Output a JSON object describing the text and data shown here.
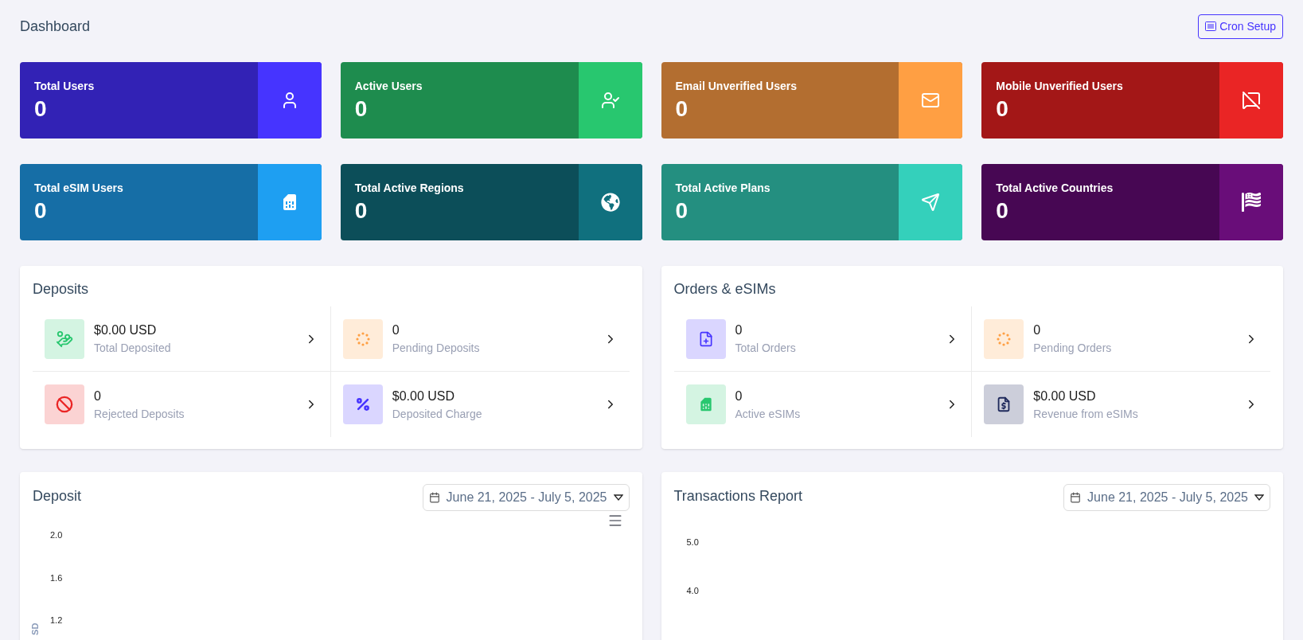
{
  "page_title": "Dashboard",
  "header_button": "Cron Setup",
  "stat_cards": [
    {
      "label": "Total Users",
      "value": "0",
      "color": "#3222b5",
      "icon_tile": {
        "color": "#4634ff"
      }
    },
    {
      "label": "Active Users",
      "value": "0",
      "color": "#1e8c4e",
      "icon_tile": {
        "color": "#28c76f"
      }
    },
    {
      "label": "Email Unverified Users",
      "value": "0",
      "color": "#b36e30",
      "icon_tile": {
        "color": "#ff9f43"
      }
    },
    {
      "label": "Mobile Unverified Users",
      "value": "0",
      "color": "#a31717",
      "icon_tile": {
        "color": "#ea2525"
      }
    },
    {
      "label": "Total eSIM Users",
      "value": "0",
      "color": "#166ea6",
      "icon_tile": {
        "color": "#1e9ff2"
      }
    },
    {
      "label": "Total Active Regions",
      "value": "0",
      "color": "#0c4e59",
      "icon_tile": {
        "color": "#10707e"
      }
    },
    {
      "label": "Total Active Plans",
      "value": "0",
      "color": "#248f80",
      "icon_tile": {
        "color": "#34d0bb"
      }
    },
    {
      "label": "Total Active Countries",
      "value": "0",
      "color": "#470753",
      "icon_tile": {
        "color": "#690d79"
      }
    }
  ],
  "panels": [
    {
      "title": "Deposits",
      "items": [
        {
          "value": "$0.00 USD",
          "label": "Total Deposited",
          "color": "#d4f4e2"
        },
        {
          "value": "0",
          "label": "Pending Deposits",
          "color": "#ffecd9"
        },
        {
          "value": "0",
          "label": "Rejected Deposits",
          "color": "#fbd3d3"
        },
        {
          "value": "$0.00 USD",
          "label": "Deposited Charge",
          "color": "#dad6ff"
        }
      ]
    },
    {
      "title": "Orders & eSIMs",
      "items": [
        {
          "value": "0",
          "label": "Total Orders",
          "color": "#dad6ff"
        },
        {
          "value": "0",
          "label": "Pending Orders",
          "color": "#ffecd9"
        },
        {
          "value": "0",
          "label": "Active eSIMs",
          "color": "#d4f4e2"
        },
        {
          "value": "$0.00 USD",
          "label": "Revenue from eSIMs",
          "color": "#ccceda"
        }
      ]
    }
  ],
  "charts": [
    {
      "title": "Deposit",
      "date_range": "June 21, 2025 - July 5, 2025",
      "menu": true,
      "y_ticks": [
        "2.0",
        "1.6",
        "1.2"
      ],
      "y_label": "SD"
    },
    {
      "title": "Transactions Report",
      "date_range": "June 21, 2025 - July 5, 2025",
      "menu": false,
      "y_ticks": [
        "5.0",
        "4.0"
      ]
    }
  ]
}
